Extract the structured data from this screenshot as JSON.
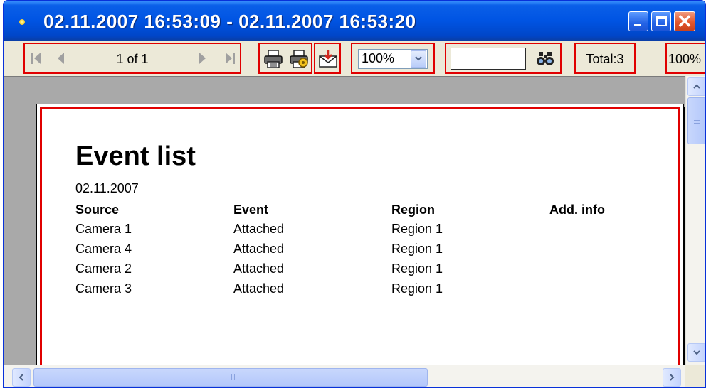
{
  "window": {
    "title": "02.11.2007 16:53:09 - 02.11.2007 16:53:20",
    "close_glyph": "✕"
  },
  "toolbar": {
    "page_info": "1 of 1",
    "zoom": {
      "selected": "100%"
    },
    "search": {
      "value": ""
    },
    "total": "Total:3",
    "zoom_percent": "100%"
  },
  "report": {
    "title": "Event list",
    "date": "02.11.2007",
    "columns": [
      "Source",
      "Event",
      "Region",
      "Add. info"
    ],
    "rows": [
      [
        "Camera 1",
        "Attached",
        "Region 1",
        ""
      ],
      [
        "Camera 4",
        "Attached",
        "Region 1",
        ""
      ],
      [
        "Camera 2",
        "Attached",
        "Region 1",
        ""
      ],
      [
        "Camera 3",
        "Attached",
        "Region 1",
        ""
      ]
    ]
  },
  "colors": {
    "highlight": "#e00000",
    "titlebar": "#0054e3",
    "report_background": "#a9a9a9"
  },
  "icons": {
    "nav": [
      "first-page-icon",
      "prev-page-icon",
      "next-page-icon",
      "last-page-icon"
    ],
    "tools": [
      "print-icon",
      "print-setup-icon",
      "export-icon",
      "find-icon"
    ]
  }
}
